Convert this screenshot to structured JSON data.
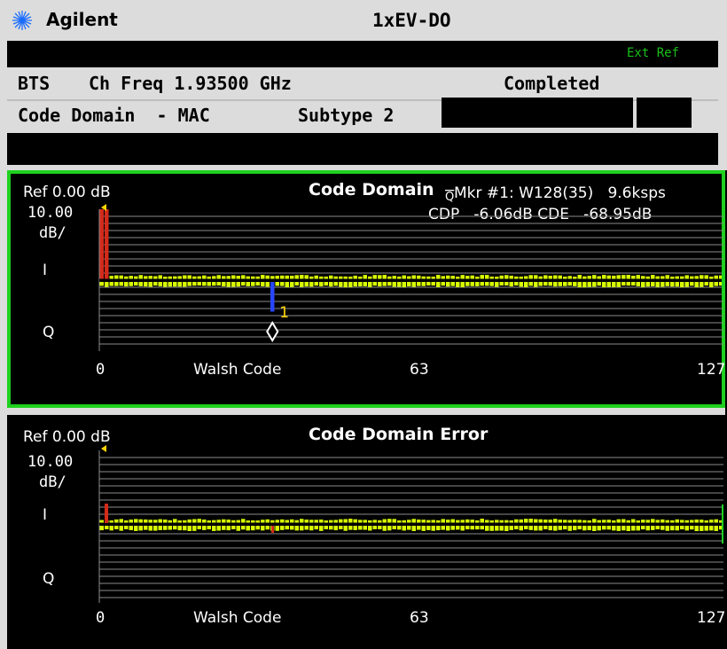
{
  "header": {
    "brand": "Agilent",
    "mode": "1xEV-DO",
    "ext_ref": "Ext Ref"
  },
  "info": {
    "bts": "BTS",
    "ch_freq": "Ch Freq 1.93500 GHz",
    "status": "Completed",
    "measurement": "Code Domain  - MAC",
    "subtype": "Subtype 2"
  },
  "colors": {
    "bar": "#d8ff00",
    "edge": "#1fd01f",
    "axis": "#ffffff",
    "red": "#d22a1a",
    "marker": "#2846ff",
    "title_bg": "#dcdcdc"
  },
  "panel1": {
    "ref": "Ref 0.00 dB",
    "scale_value": "10.00",
    "scale_unit": "dB/",
    "i_label": "I",
    "q_label": "Q",
    "title": "Code Domain",
    "marker_icon": "Q",
    "marker_line": "Mkr #1: W128(35)   9.6ksps",
    "cdp_line": "CDP   -6.06dB CDE   -68.95dB",
    "marker_number": "1",
    "marker_code": 35,
    "x_start": "0",
    "x_label": "Walsh Code",
    "x_mid": "63",
    "x_end": "127"
  },
  "panel2": {
    "ref": "Ref 0.00 dB",
    "scale_value": "10.00",
    "scale_unit": "dB/",
    "i_label": "I",
    "q_label": "Q",
    "title": "Code Domain Error",
    "x_start": "0",
    "x_label": "Walsh Code",
    "x_mid": "63",
    "x_end": "127"
  },
  "chart_data": [
    {
      "type": "bar",
      "title": "Code Domain",
      "xlabel": "Walsh Code",
      "ylabel": "dB",
      "x_ticks": [
        "0",
        "63",
        "127"
      ],
      "xlim": [
        0,
        127
      ],
      "ref_level_db": 0.0,
      "scale_db_per_div": 10.0,
      "series": [
        {
          "name": "I",
          "active_codes_db": [
            {
              "code": 0,
              "value": 0.0
            },
            {
              "code": 1,
              "value": 0.0
            }
          ],
          "noise_level_db": -28
        },
        {
          "name": "Q",
          "active_codes_db": [
            {
              "code": 35,
              "value": -6.06
            }
          ],
          "noise_level_db": -28
        }
      ],
      "marker": {
        "label": "1",
        "code": 35,
        "cdp_db": -6.06,
        "cde_db": -68.95,
        "symbol_rate": "9.6ksps"
      }
    },
    {
      "type": "bar",
      "title": "Code Domain Error",
      "xlabel": "Walsh Code",
      "ylabel": "dB",
      "x_ticks": [
        "0",
        "63",
        "127"
      ],
      "xlim": [
        0,
        127
      ],
      "ref_level_db": 0.0,
      "scale_db_per_div": 10.0,
      "series": [
        {
          "name": "I",
          "noise_level_db": -28
        },
        {
          "name": "Q",
          "noise_level_db": -28
        }
      ]
    }
  ]
}
